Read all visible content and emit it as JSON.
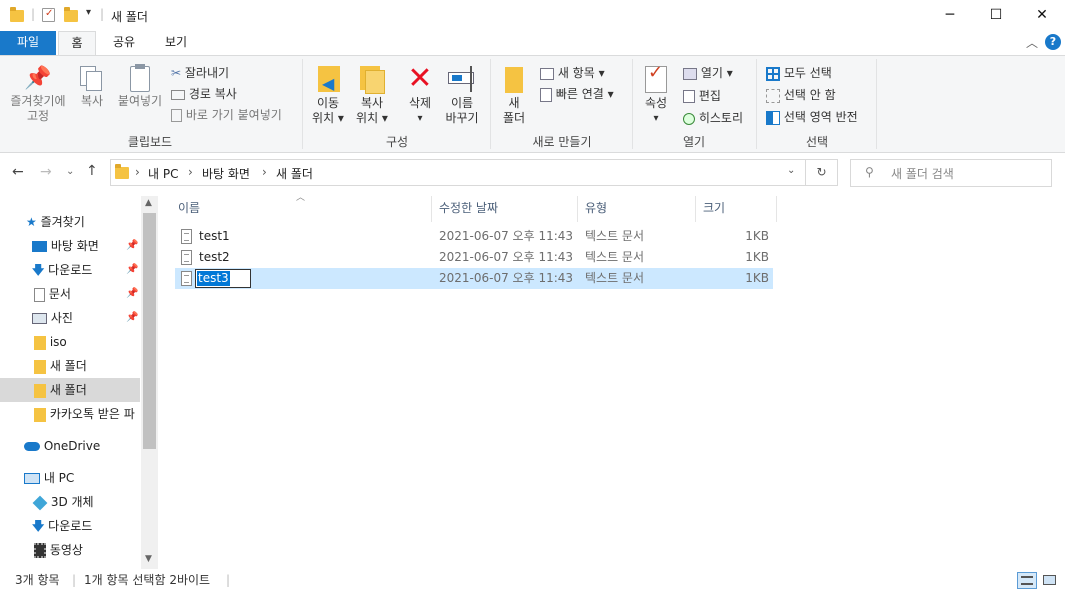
{
  "window": {
    "title": "새 폴더",
    "minimize": "─",
    "maximize": "☐",
    "close": "✕"
  },
  "tabs": {
    "file": "파일",
    "home": "홈",
    "share": "공유",
    "view": "보기"
  },
  "ribbon": {
    "clipboard": {
      "pin_line1": "즐겨찾기에",
      "pin_line2": "고정",
      "copy": "복사",
      "paste": "붙여넣기",
      "cut": "잘라내기",
      "copy_path": "경로 복사",
      "paste_shortcut": "바로 가기 붙여넣기",
      "label": "클립보드"
    },
    "organize": {
      "move_line1": "이동",
      "move_line2": "위치 ▾",
      "copyto_line1": "복사",
      "copyto_line2": "위치 ▾",
      "delete_line1": "삭제",
      "delete_line2": "▾",
      "rename_line1": "이름",
      "rename_line2": "바꾸기",
      "label": "구성"
    },
    "new": {
      "folder_line1": "새",
      "folder_line2": "폴더",
      "new_item": "새 항목 ▾",
      "easy_access": "빠른 연결 ▾",
      "label": "새로 만들기"
    },
    "open": {
      "props_line1": "속성",
      "props_line2": "▾",
      "open": "열기 ▾",
      "edit": "편집",
      "history": "히스토리",
      "label": "열기"
    },
    "select": {
      "all": "모두 선택",
      "none": "선택 안 함",
      "invert": "선택 영역 반전",
      "label": "선택"
    }
  },
  "address": {
    "crumb1": "내 PC",
    "crumb2": "바탕 화면",
    "crumb3": "새 폴더",
    "search_placeholder": "새 폴더 검색"
  },
  "nav": {
    "quick_access": "즐겨찾기",
    "items": [
      {
        "label": "바탕 화면",
        "icon": "desktop-icon"
      },
      {
        "label": "다운로드",
        "icon": "download-icon"
      },
      {
        "label": "문서",
        "icon": "document-icon"
      },
      {
        "label": "사진",
        "icon": "picture-icon"
      },
      {
        "label": "iso",
        "icon": "folder-icon"
      },
      {
        "label": "새 폴더",
        "icon": "folder-icon"
      },
      {
        "label": "새 폴더",
        "icon": "folder-icon"
      },
      {
        "label": "카카오톡 받은 파",
        "icon": "folder-icon"
      }
    ],
    "onedrive": "OneDrive",
    "thispc": "내 PC",
    "pc_items": [
      {
        "label": "3D 개체",
        "icon": "cube-icon"
      },
      {
        "label": "다운로드",
        "icon": "download-icon"
      },
      {
        "label": "동영상",
        "icon": "video-icon"
      }
    ]
  },
  "columns": {
    "name": "이름",
    "date": "수정한 날짜",
    "type": "유형",
    "size": "크기"
  },
  "files": [
    {
      "name": "test1",
      "date": "2021-06-07 오후 11:43",
      "type": "텍스트 문서",
      "size": "1KB"
    },
    {
      "name": "test2",
      "date": "2021-06-07 오후 11:43",
      "type": "텍스트 문서",
      "size": "1KB"
    },
    {
      "name": "test3",
      "date": "2021-06-07 오후 11:43",
      "type": "텍스트 문서",
      "size": "1KB"
    }
  ],
  "status": {
    "count": "3개 항목",
    "selected": "1개 항목 선택함 2바이트"
  },
  "colors": {
    "accent": "#1979ca",
    "selection": "#cce8ff",
    "folder": "#f5c342",
    "delete_red": "#e81123"
  }
}
